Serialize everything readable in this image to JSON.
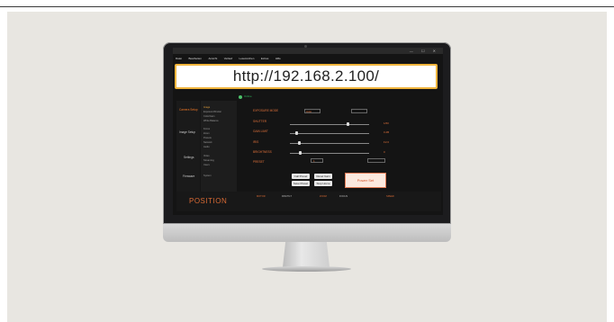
{
  "browser": {
    "url": "http://192.168.2.100/",
    "menu": [
      "Datei",
      "Bearbeiten",
      "Ansicht",
      "Verlauf",
      "Lesezeichen",
      "Extras",
      "Hilfe"
    ]
  },
  "status": {
    "label": "Online"
  },
  "sidebar": {
    "categories": [
      "Camera Setup",
      "Image Setup",
      "Settings",
      "Firmware"
    ],
    "subitems": [
      "Image",
      "Exposure/Shutter",
      "Color/Gain",
      "White Balance",
      "Focus",
      "Zoom",
      "Presets",
      "Network",
      "Audio",
      "Video",
      "Streaming",
      "Users",
      "System"
    ]
  },
  "controls": {
    "params": [
      "EXPOSURE MODE",
      "SHUTTER",
      "GAIN LIMIT",
      "IRIS",
      "BRIGHTNESS",
      "PRESET"
    ],
    "values": [
      "Auto",
      "1/60",
      "0 dB",
      "F2.0",
      "0",
      "1"
    ],
    "buttons": [
      "Call Preset",
      "Reset Gain",
      "Save Preset",
      "Stop Home"
    ],
    "power_label": "Power Set"
  },
  "bottom": {
    "title": "POSITION",
    "stats": [
      "MOTOR",
      "PAN/TILT",
      "ZOOM",
      "FOCUS",
      "SPEED"
    ]
  },
  "colors": {
    "accent": "#f07826",
    "url_border": "#f0b43c"
  }
}
